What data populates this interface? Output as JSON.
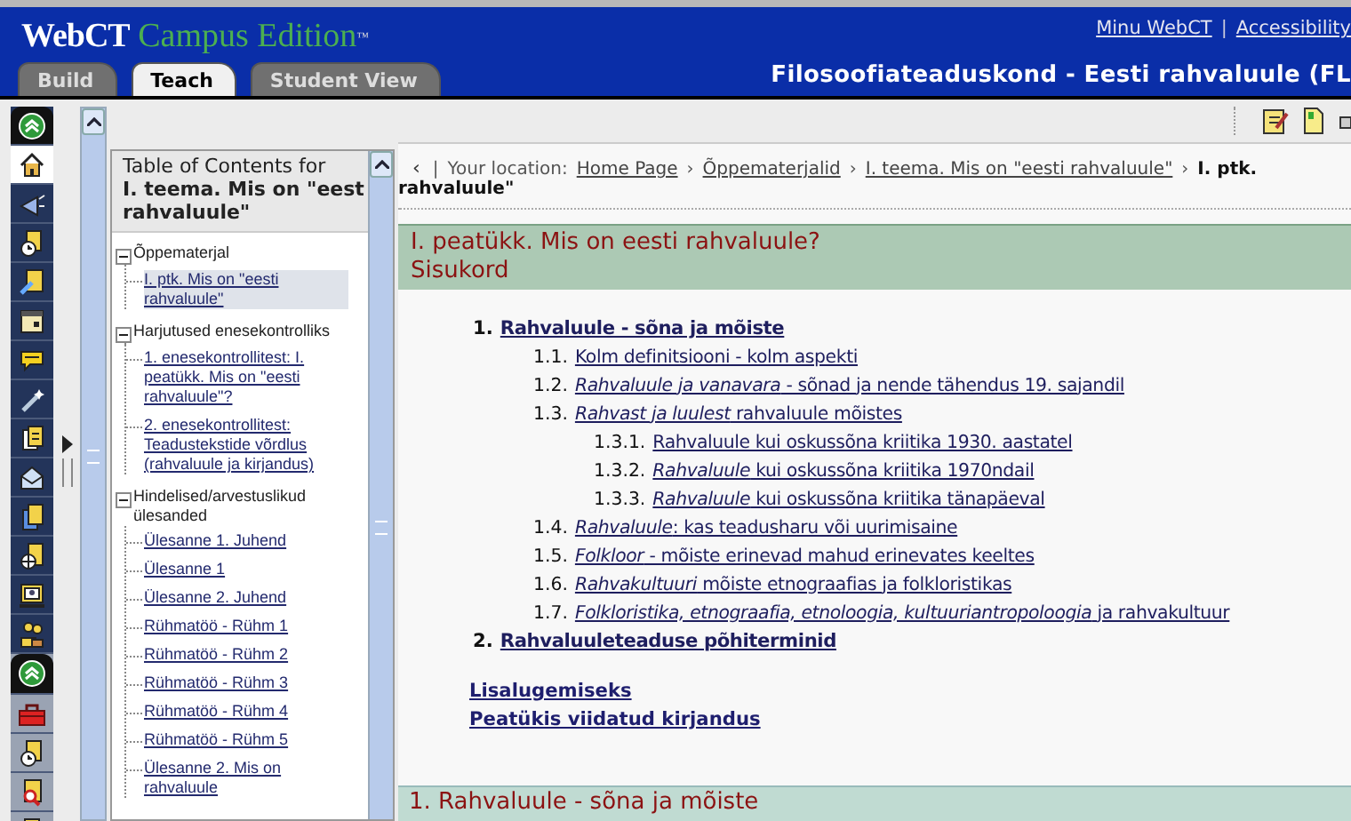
{
  "header": {
    "logo": "WebCT",
    "product": "Campus Edition",
    "trademark": "™",
    "top_links": [
      "Minu WebCT",
      "Accessibility"
    ],
    "separator": "|",
    "course_title": "Filosoofiateaduskond - Eesti rahvaluule (FL"
  },
  "tabs": [
    {
      "label": "Build",
      "selected": false
    },
    {
      "label": "Teach",
      "selected": true
    },
    {
      "label": "Student View",
      "selected": false
    }
  ],
  "toc": {
    "heading": "Table of Contents for",
    "title_lines": [
      "I. teema. Mis on \"eest",
      "rahvaluule\""
    ],
    "tree": [
      {
        "label": "Õppematerjal",
        "expanded": true,
        "children": [
          {
            "label": "I. ptk. Mis on \"eesti rahvaluule\"",
            "selected": true
          }
        ]
      },
      {
        "label": "Harjutused enesekontrolliks",
        "expanded": true,
        "children": [
          {
            "label": "1. enesekontrollitest: I. peatükk. Mis on \"eesti rahvaluule\"?",
            "selected": false
          },
          {
            "label": "2. enesekontrollitest: Teadustekstide võrdlus (rahvaluule ja kirjandus)",
            "selected": false
          }
        ]
      },
      {
        "label": "Hindelised/arvestuslikud ülesanded",
        "expanded": true,
        "children": [
          {
            "label": "Ülesanne 1. Juhend",
            "selected": false
          },
          {
            "label": "Ülesanne 1",
            "selected": false
          },
          {
            "label": "Ülesanne 2. Juhend",
            "selected": false
          },
          {
            "label": "Rühmatöö - Rühm 1",
            "selected": false
          },
          {
            "label": "Rühmatöö - Rühm 2",
            "selected": false
          },
          {
            "label": "Rühmatöö - Rühm 3",
            "selected": false
          },
          {
            "label": "Rühmatöö - Rühm 4",
            "selected": false
          },
          {
            "label": "Rühmatöö - Rühm 5",
            "selected": false
          },
          {
            "label": "Ülesanne 2. Mis on rahvaluule",
            "selected": false
          }
        ]
      }
    ]
  },
  "breadcrumb": {
    "back": "‹",
    "separator": "|",
    "label": "Your location:",
    "links": [
      "Home Page",
      "Õppematerjalid",
      "I. teema. Mis on \"eesti rahvaluule\""
    ],
    "arrow": "›",
    "current_lines": [
      "I. ptk.",
      "rahvaluule\""
    ]
  },
  "chapter": {
    "title": "I. peatükk. Mis on eesti rahvaluule?",
    "subtitle": "Sisukord"
  },
  "contents": [
    {
      "number": "1.",
      "text": "Rahvaluule - sõna ja mõiste",
      "children": [
        {
          "number": "1.1.",
          "text": "Kolm definitsiooni - kolm aspekti"
        },
        {
          "number": "1.2.",
          "text": "*Rahvaluule ja vanavara* - sõnad ja nende tähendus 19. sajandil"
        },
        {
          "number": "1.3.",
          "text": "*Rahvast ja luulest* rahvaluule mõistes",
          "children": [
            {
              "number": "1.3.1.",
              "text": "Rahvaluule kui oskussõna kriitika 1930. aastatel"
            },
            {
              "number": "1.3.2.",
              "text": "*Rahvaluule* kui oskussõna kriitika 1970ndail"
            },
            {
              "number": "1.3.3.",
              "text": "*Rahvaluule* kui oskussõna kriitika tänapäeval"
            }
          ]
        },
        {
          "number": "1.4.",
          "text": "*Rahvaluule*: kas teadusharu või uurimisaine"
        },
        {
          "number": "1.5.",
          "text": "*Folkloor* - mõiste erinevad mahud erinevates keeltes"
        },
        {
          "number": "1.6.",
          "text": "*Rahvakultuuri* mõiste etnograafias ja folkloristikas"
        },
        {
          "number": "1.7.",
          "text": "*Folkloristika, etnograafia, etnoloogia, kultuuriantropoloogia* ja rahvakultuur"
        }
      ]
    },
    {
      "number": "2.",
      "text": "Rahvaluuleteaduse põhiterminid"
    }
  ],
  "extra_links": [
    "Lisalugemiseks",
    "Peatükis viidatud kirjandus"
  ],
  "section": {
    "title": "1. Rahvaluule - sõna ja mõiste"
  }
}
